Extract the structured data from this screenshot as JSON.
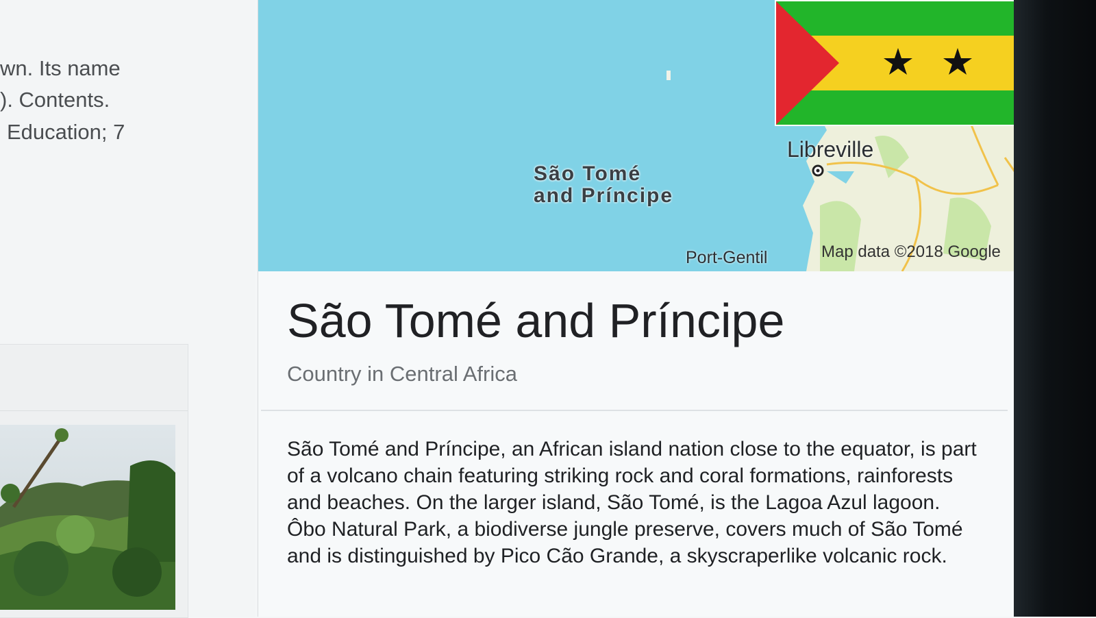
{
  "left_snippet": {
    "lines": [
      "wn. Its name",
      "). Contents.",
      "Education; 7"
    ]
  },
  "map": {
    "country_label_line1": "São Tomé",
    "country_label_line2": "and Príncipe",
    "city_libreville": "Libreville",
    "city_port_gentil": "Port-Gentil",
    "attribution": "Map data ©2018 Google",
    "colors": {
      "sea": "#80d2e6",
      "land": "#eef0dc",
      "roads": "#f1c24a"
    }
  },
  "flag": {
    "description_icon": "sao-tome-flag-icon",
    "colors": {
      "green": "#22b52a",
      "yellow": "#f5d020",
      "red": "#e3262f",
      "star": "#111111"
    }
  },
  "panel": {
    "title": "São Tomé and Príncipe",
    "subtitle": "Country in Central Africa",
    "description": "São Tomé and Príncipe, an African island nation close to the equator, is part of a volcano chain featuring striking rock and coral formations, rainforests and beaches. On the larger island, São Tomé, is the Lagoa Azul lagoon. Ôbo Natural Park, a biodiverse jungle preserve, covers much of São Tomé and is distinguished by Pico Cão Grande, a skyscraperlike volcanic rock."
  }
}
